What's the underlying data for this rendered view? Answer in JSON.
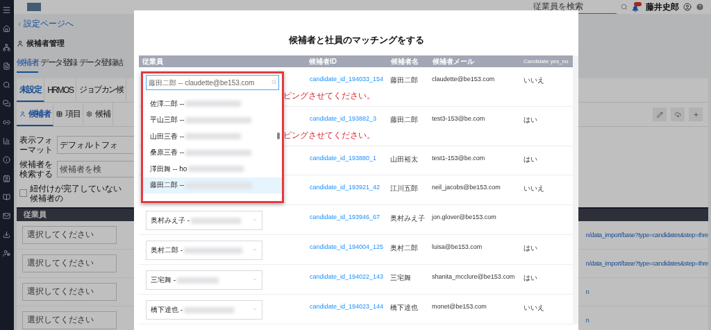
{
  "topbar": {
    "search": {
      "placeholder": "従業員を検索"
    },
    "user_name": "藤井史郎"
  },
  "page": {
    "back_link": "設定ページへ",
    "title": "候補者管理",
    "tabs": [
      {
        "label": "候補者",
        "selected": true
      },
      {
        "label": "データ登録",
        "selected": false
      },
      {
        "label": "データ登録結",
        "selected": false
      }
    ],
    "source_tabs": [
      {
        "label": "未設定",
        "selected": true
      },
      {
        "label": "HRMOS",
        "selected": false
      },
      {
        "label": "ジョブカン候",
        "selected": false
      }
    ],
    "view_tabs": [
      {
        "label": "候補者",
        "selected": true
      },
      {
        "label": "項目",
        "selected": false
      },
      {
        "label": "候補",
        "selected": false
      }
    ],
    "format": {
      "label": "表示フォーマット",
      "value": "デフォルトフォ"
    },
    "search": {
      "label": "候補者を検索する",
      "placeholder": "候補者を検"
    },
    "filter": {
      "label": "紐付けが完了していない候補者の",
      "checked": false
    },
    "table": {
      "column_1": "従業員",
      "rows": [
        {
          "placeholder": "選択してください",
          "link": "n/data_import/base?type=candidates&step=thre"
        },
        {
          "placeholder": "選択してください",
          "link": "n/data_import/base?type=candidates&step=thre"
        },
        {
          "placeholder": "選択してください",
          "link": "n"
        },
        {
          "placeholder": "選択してください",
          "link": "n"
        }
      ]
    }
  },
  "modal": {
    "title": "候補者と社員のマッチングをする",
    "columns": [
      "従業員",
      "候補者ID",
      "候補者名",
      "候補者メール",
      "Candidate yes_no"
    ],
    "rows": [
      {
        "id": "candidate_id_194033_154",
        "name": "藤田二郎",
        "email": "claudette@be153.com",
        "yes_no": "いいえ",
        "error": "ピングさせてください。"
      },
      {
        "id": "candidate_id_193882_3",
        "name": "藤田二郎",
        "email": "test3-153@be.com",
        "yes_no": "はい",
        "error": "ピングさせてください。"
      },
      {
        "id": "candidate_id_193880_1",
        "name": "山田裕太",
        "email": "test1-153@be.com",
        "yes_no": "はい"
      },
      {
        "id": "candidate_id_193921_42",
        "name": "江川五郎",
        "email": "neil_jacobs@be153.com",
        "yes_no": "いいえ"
      },
      {
        "employee": "奥村みえ子 -",
        "id": "candidate_id_193946_67",
        "name": "奥村みえ子",
        "email": "jon.glover@be153.com"
      },
      {
        "employee": "奥村二郎 -",
        "id": "candidate_id_194004_125",
        "name": "奥村二郎",
        "email": "luisa@be153.com",
        "yes_no": "はい"
      },
      {
        "employee": "三宅舞 -",
        "id": "candidate_id_194022_143",
        "name": "三宅舞",
        "email": "shanita_mcclure@be153.com",
        "yes_no": "はい"
      },
      {
        "employee": "橋下達也 -",
        "id": "candidate_id_194023_144",
        "name": "橋下達也",
        "email": "monet@be153.com",
        "yes_no": "いいえ"
      }
    ],
    "dropdown": {
      "placeholder": "藤田二郎 -- claudette@be153.com",
      "options": [
        {
          "label": "佐澤二郎 --",
          "selected": false
        },
        {
          "label": "平山三郎 --",
          "selected": false
        },
        {
          "label": "山田三香 --",
          "selected": false
        },
        {
          "label": "桑原三香 --",
          "selected": false
        },
        {
          "label": "澤田舞 -- ho",
          "selected": false
        },
        {
          "label": "藤田二郎 --",
          "selected": true
        }
      ]
    }
  }
}
